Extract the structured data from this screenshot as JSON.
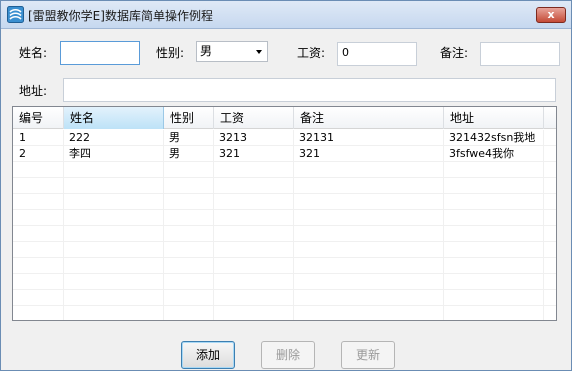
{
  "window": {
    "title": "[雷盟教你学E]数据库简单操作例程",
    "close_label": "x"
  },
  "form": {
    "name_label": "姓名:",
    "name_value": "",
    "gender_label": "性别:",
    "gender_value": "男",
    "salary_label": "工资:",
    "salary_value": "0",
    "note_label": "备注:",
    "note_value": "",
    "address_label": "地址:",
    "address_value": ""
  },
  "table": {
    "columns": [
      "编号",
      "姓名",
      "性别",
      "工资",
      "备注",
      "地址"
    ],
    "rows": [
      [
        "1",
        "222",
        "男",
        "3213",
        "32131",
        "321432sfsn我地"
      ],
      [
        "2",
        "李四",
        "男",
        "321",
        "321",
        "3fsfwe4我你"
      ]
    ]
  },
  "buttons": {
    "add": "添加",
    "delete": "删除",
    "update": "更新"
  },
  "colors": {
    "title_gradient_top": "#dfe9f6",
    "selected_header": "#bde2f7",
    "close_red": "#c44a36"
  }
}
